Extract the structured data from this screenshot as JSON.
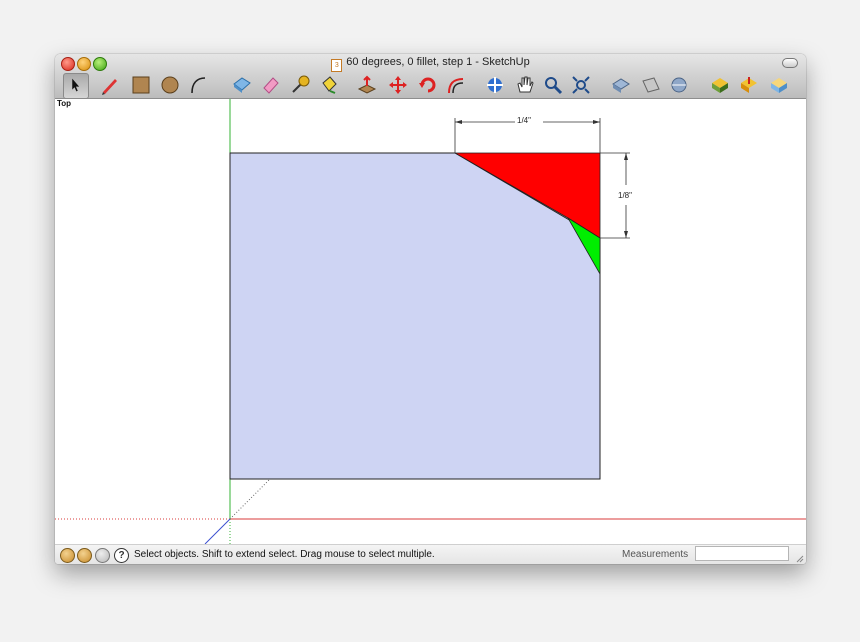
{
  "window": {
    "title": "60 degrees, 0 fillet, step 1 - SketchUp",
    "doc_icon": "skp-document-icon"
  },
  "toolbar": {
    "tools": [
      {
        "name": "select-tool",
        "icon": "arrow-cursor-icon"
      },
      {
        "name": "pencil-tool",
        "icon": "pencil-icon"
      },
      {
        "name": "rectangle-tool",
        "icon": "rectangle-icon"
      },
      {
        "name": "circle-tool",
        "icon": "circle-icon"
      },
      {
        "name": "arc-tool",
        "icon": "arc-icon"
      },
      {
        "name": "make-component-tool",
        "icon": "component-icon"
      },
      {
        "name": "eraser-tool",
        "icon": "eraser-icon"
      },
      {
        "name": "tape-measure-tool",
        "icon": "tape-measure-icon"
      },
      {
        "name": "paint-bucket-tool",
        "icon": "paint-bucket-icon"
      },
      {
        "name": "push-pull-tool",
        "icon": "push-pull-icon"
      },
      {
        "name": "move-tool",
        "icon": "move-icon"
      },
      {
        "name": "rotate-tool",
        "icon": "rotate-icon"
      },
      {
        "name": "offset-tool",
        "icon": "offset-icon"
      },
      {
        "name": "orbit-tool",
        "icon": "orbit-icon"
      },
      {
        "name": "pan-tool",
        "icon": "hand-icon"
      },
      {
        "name": "zoom-tool",
        "icon": "magnifier-icon"
      },
      {
        "name": "zoom-extents-tool",
        "icon": "zoom-extents-icon"
      },
      {
        "name": "previous-view-tool",
        "icon": "previous-view-icon"
      },
      {
        "name": "next-view-tool",
        "icon": "next-view-icon"
      },
      {
        "name": "standard-views-tool",
        "icon": "standard-views-icon"
      },
      {
        "name": "3d-warehouse-tool",
        "icon": "warehouse-icon"
      },
      {
        "name": "share-model-tool",
        "icon": "share-model-icon"
      },
      {
        "name": "component-browser-tool",
        "icon": "components-icon"
      }
    ]
  },
  "viewport": {
    "scene_label": "Top",
    "dimension_horizontal": "1/4\"",
    "dimension_vertical": "1/8\"",
    "colors": {
      "face": "#ced4f3",
      "red_region": "#ff0000",
      "green_region": "#00ee00",
      "axis_green": "#34b334",
      "axis_red": "#d93b3b",
      "axis_blue": "#3a4fd0"
    }
  },
  "statusbar": {
    "message": "Select objects. Shift to extend select. Drag mouse to select multiple.",
    "measurements_label": "Measurements",
    "measurements_value": "",
    "icons": [
      "geo-location-icon",
      "credits-icon",
      "user-icon",
      "help-icon"
    ]
  }
}
